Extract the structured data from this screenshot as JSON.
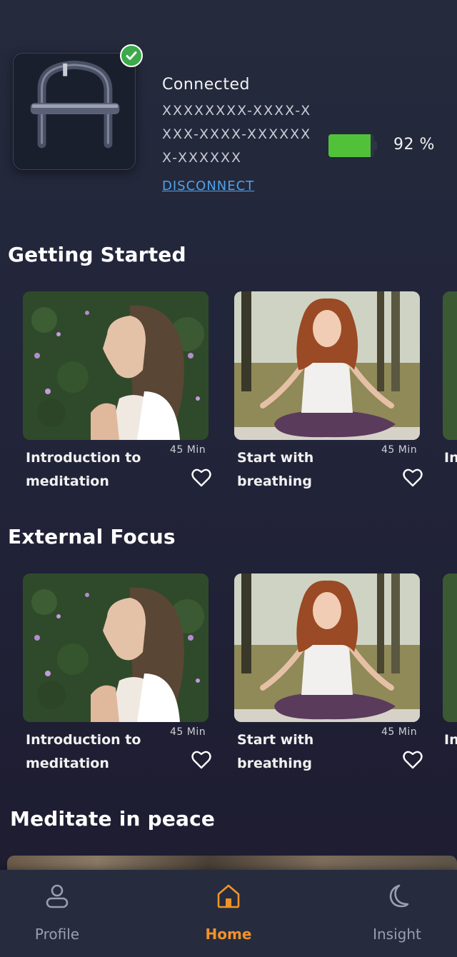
{
  "device": {
    "status": "Connected",
    "id": "XXXXXXXX-XXXX-XXXX-XXXX-XXXXXXX-XXXXXX",
    "action": "DISCONNECT",
    "battery_percent": 92,
    "battery_label": "92 %",
    "battery_color": "#52c13a",
    "status_icon": "check-icon"
  },
  "sections": [
    {
      "title": "Getting Started",
      "cards": [
        {
          "title": "Introduction to meditation",
          "duration": "45 Min",
          "image": "woman-profile-flowers"
        },
        {
          "title": "Start with breathing",
          "duration": "45 Min",
          "image": "woman-lotus-pose"
        },
        {
          "title": "In m",
          "duration": "",
          "image": "partial-card"
        }
      ]
    },
    {
      "title": "External Focus",
      "cards": [
        {
          "title": "Introduction to meditation",
          "duration": "45 Min",
          "image": "woman-profile-flowers"
        },
        {
          "title": "Start with breathing",
          "duration": "45 Min",
          "image": "woman-lotus-pose"
        },
        {
          "title": "In m",
          "duration": "",
          "image": "partial-card"
        }
      ]
    },
    {
      "title": "Meditate in peace",
      "cards": []
    }
  ],
  "nav": {
    "items": [
      {
        "label": "Profile",
        "icon": "user-icon",
        "active": false
      },
      {
        "label": "Home",
        "icon": "home-icon",
        "active": true
      },
      {
        "label": "Insight",
        "icon": "moon-icon",
        "active": false
      }
    ],
    "active_color": "#f2922a",
    "inactive_color": "#9a9eae"
  }
}
